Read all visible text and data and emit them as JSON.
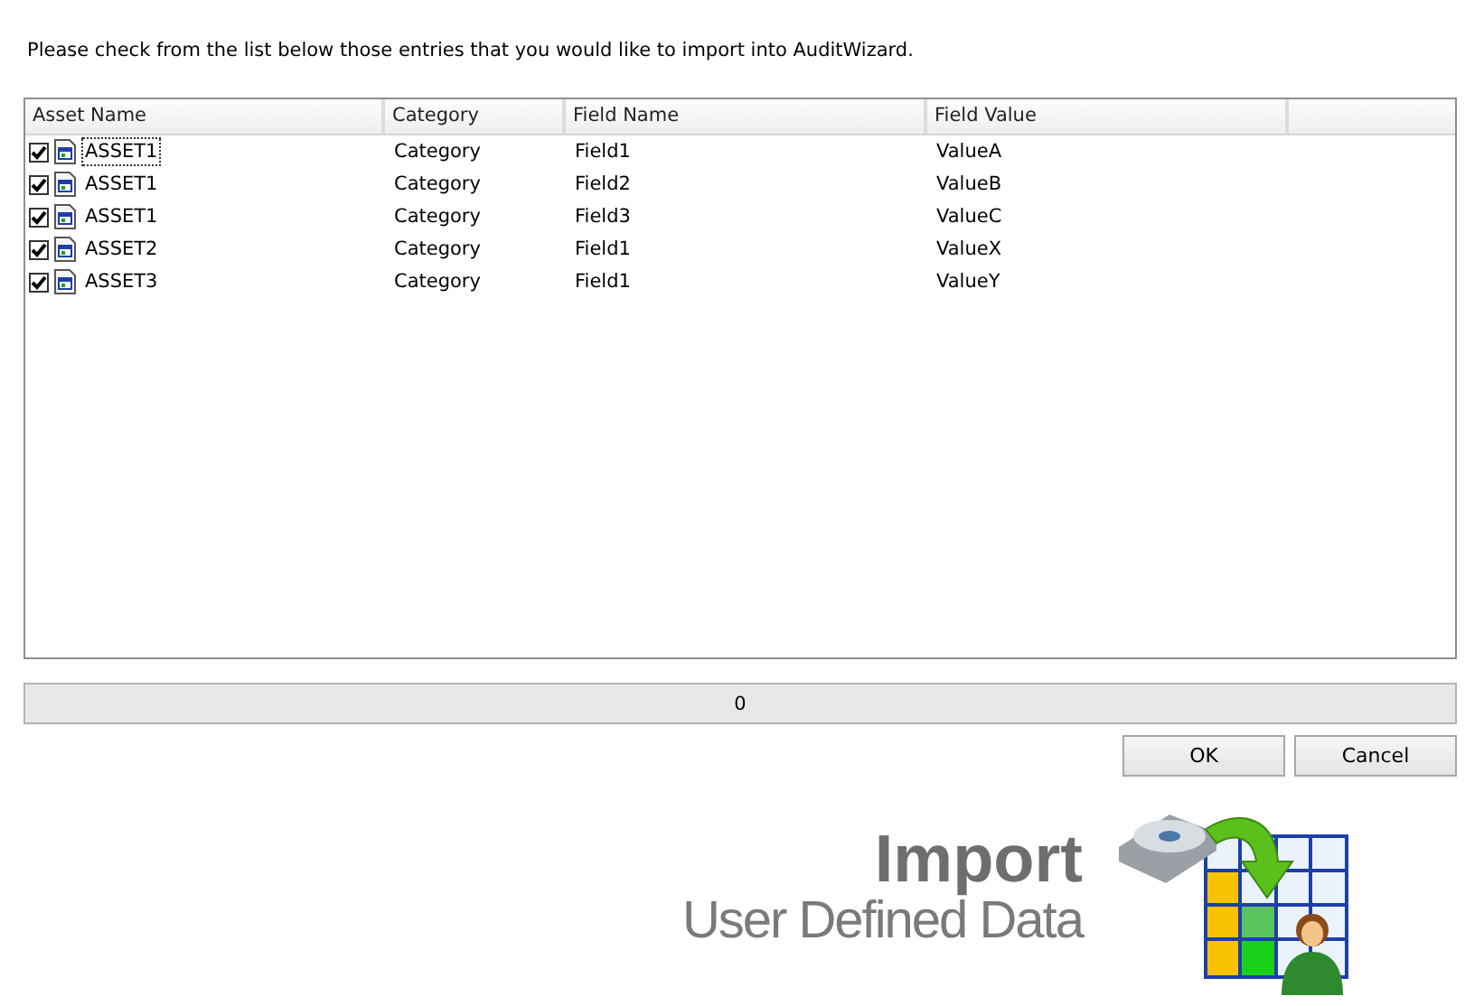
{
  "instruction": "Please check from the list below those entries that you would like to import into AuditWizard.",
  "table": {
    "columns": [
      "Asset Name",
      "Category",
      "Field Name",
      "Field Value"
    ],
    "rows": [
      {
        "checked": true,
        "selected": true,
        "cells": [
          "ASSET1",
          "Category",
          "Field1",
          "ValueA"
        ]
      },
      {
        "checked": true,
        "selected": false,
        "cells": [
          "ASSET1",
          "Category",
          "Field2",
          "ValueB"
        ]
      },
      {
        "checked": true,
        "selected": false,
        "cells": [
          "ASSET1",
          "Category",
          "Field3",
          "ValueC"
        ]
      },
      {
        "checked": true,
        "selected": false,
        "cells": [
          "ASSET2",
          "Category",
          "Field1",
          "ValueX"
        ]
      },
      {
        "checked": true,
        "selected": false,
        "cells": [
          "ASSET3",
          "Category",
          "Field1",
          "ValueY"
        ]
      }
    ]
  },
  "status_bar": {
    "text": "0"
  },
  "buttons": [
    "OK",
    "Cancel"
  ],
  "banner": {
    "title": "Import",
    "subtitle": "User Defined Data"
  }
}
